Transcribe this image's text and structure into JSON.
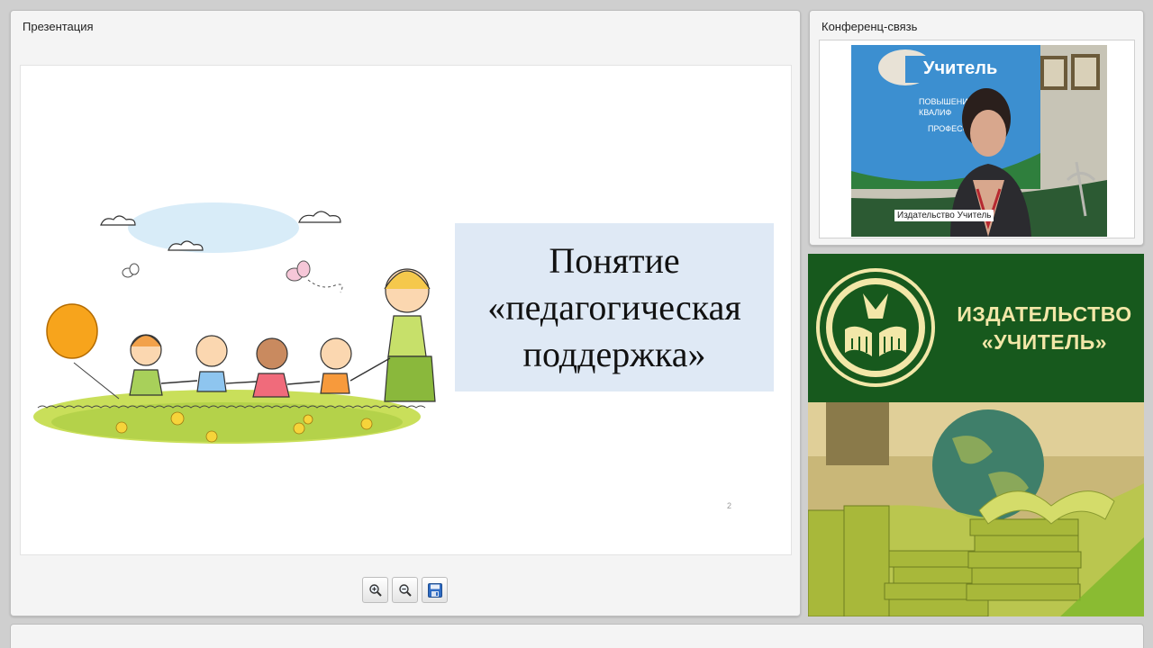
{
  "presentation": {
    "panel_title": "Презентация",
    "slide_title": "Понятие\n«педагогическая\nподдержка»",
    "slide_number": "2",
    "toolbar": [
      {
        "icon": "zoom-in-icon"
      },
      {
        "icon": "zoom-out-icon"
      },
      {
        "icon": "save-icon"
      }
    ]
  },
  "conference": {
    "panel_title": "Конференц-связь",
    "video_label": "Издательство Учитель"
  },
  "publisher": {
    "name": "ИЗДАТЕЛЬСТВО\n«УЧИТЕЛЬ»"
  },
  "colors": {
    "banner_green": "#17591d",
    "banner_text": "#f2e7a8",
    "slide_title_bg": "#dfe9f5"
  }
}
